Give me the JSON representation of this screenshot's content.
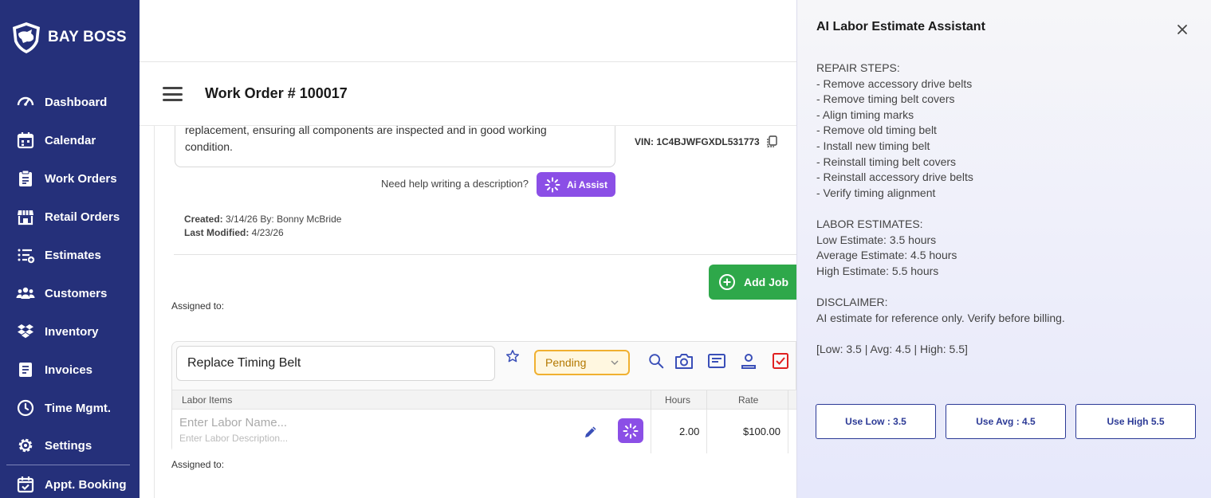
{
  "brand": {
    "name": "BAY BOSS"
  },
  "sidebar": {
    "items": [
      {
        "label": "Dashboard",
        "icon": "dashboard-gauge-icon"
      },
      {
        "label": "Calendar",
        "icon": "calendar-icon"
      },
      {
        "label": "Work Orders",
        "icon": "clipboard-icon"
      },
      {
        "label": "Retail Orders",
        "icon": "store-icon"
      },
      {
        "label": "Estimates",
        "icon": "list-add-icon"
      },
      {
        "label": "Customers",
        "icon": "users-icon"
      },
      {
        "label": "Inventory",
        "icon": "dropbox-icon"
      },
      {
        "label": "Invoices",
        "icon": "document-icon"
      },
      {
        "label": "Time Mgmt.",
        "icon": "clock-icon"
      },
      {
        "label": "Settings",
        "icon": "gear-icon"
      },
      {
        "label": "Appt. Booking",
        "icon": "calendar-check-icon"
      }
    ]
  },
  "header": {
    "title": "Work Order # 100017"
  },
  "work_order": {
    "description_line1": "replacement, ensuring all components are inspected and in good working",
    "description_line2": "condition.",
    "vin_label": "VIN:",
    "vin": "1C4BJWFGXDL531773",
    "help_text": "Need help writing a description?",
    "ai_assist_label": "Ai Assist",
    "created_label": "Created:",
    "created_value": "3/14/26 By: Bonny McBride",
    "modified_label": "Last Modified:",
    "modified_value": "4/23/26",
    "add_job_label": "Add Job",
    "assigned_label": "Assigned to:"
  },
  "job": {
    "name": "Replace Timing Belt",
    "status": "Pending",
    "columns": {
      "labor_items": "Labor Items",
      "hours": "Hours",
      "rate": "Rate"
    },
    "labor_name_placeholder": "Enter Labor Name...",
    "labor_desc_placeholder": "Enter Labor Description...",
    "hours": "2.00",
    "rate": "$100.00",
    "assigned_label": "Assigned to:"
  },
  "ai_panel": {
    "title": "AI Labor Estimate Assistant",
    "lines": [
      "REPAIR STEPS:",
      "- Remove accessory drive belts",
      "- Remove timing belt covers",
      "- Align timing marks",
      "- Remove old timing belt",
      "- Install new timing belt",
      "- Reinstall timing belt covers",
      "- Reinstall accessory drive belts",
      "- Verify timing alignment",
      "",
      "LABOR ESTIMATES:",
      "Low Estimate: 3.5 hours",
      "Average Estimate: 4.5 hours",
      "High Estimate: 5.5 hours",
      "",
      "DISCLAIMER:",
      "AI estimate for reference only. Verify before billing.",
      "",
      "[Low: 3.5 | Avg: 4.5 | High: 5.5]"
    ],
    "buttons": {
      "low": "Use Low : 3.5",
      "avg": "Use Avg : 4.5",
      "high": "Use High 5.5"
    }
  },
  "colors": {
    "sidebar": "#25307a",
    "accent_purple": "#8b4fe6",
    "add_job_green": "#2ea84a",
    "status_amber": "#f0b030",
    "icon_blue": "#3a4fb8",
    "danger_red": "#e02020"
  }
}
